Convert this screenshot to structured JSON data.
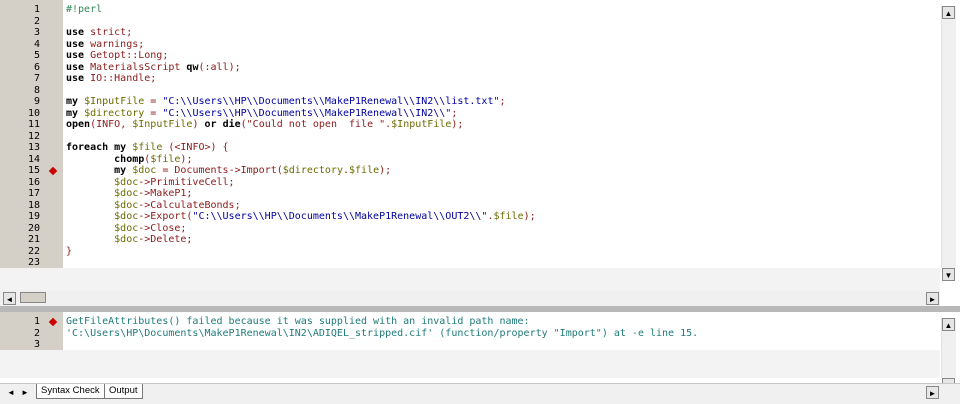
{
  "editor": {
    "lines": [
      {
        "n": "1",
        "segs": [
          {
            "t": "#!perl",
            "c": "cmt"
          }
        ]
      },
      {
        "n": "2",
        "segs": []
      },
      {
        "n": "3",
        "segs": [
          {
            "t": "use",
            "c": "kw"
          },
          {
            "t": " strict;",
            "c": "id"
          }
        ]
      },
      {
        "n": "4",
        "segs": [
          {
            "t": "use",
            "c": "kw"
          },
          {
            "t": " warnings;",
            "c": "id"
          }
        ]
      },
      {
        "n": "5",
        "segs": [
          {
            "t": "use",
            "c": "kw"
          },
          {
            "t": " Getopt::Long;",
            "c": "id"
          }
        ]
      },
      {
        "n": "6",
        "segs": [
          {
            "t": "use",
            "c": "kw"
          },
          {
            "t": " MaterialsScript ",
            "c": "id"
          },
          {
            "t": "qw",
            "c": "kw"
          },
          {
            "t": "(:all);",
            "c": "id"
          }
        ]
      },
      {
        "n": "7",
        "segs": [
          {
            "t": "use",
            "c": "kw"
          },
          {
            "t": " IO::Handle;",
            "c": "id"
          }
        ]
      },
      {
        "n": "8",
        "segs": []
      },
      {
        "n": "9",
        "segs": [
          {
            "t": "my",
            "c": "kw"
          },
          {
            "t": " $InputFile",
            "c": "var"
          },
          {
            "t": " = ",
            "c": "id"
          },
          {
            "t": "\"C:\\\\Users\\\\HP\\\\Documents\\\\MakeP1Renewal\\\\IN2\\\\list.txt\"",
            "c": "str"
          },
          {
            "t": ";",
            "c": "id"
          }
        ]
      },
      {
        "n": "10",
        "segs": [
          {
            "t": "my",
            "c": "kw"
          },
          {
            "t": " $directory",
            "c": "var"
          },
          {
            "t": " = ",
            "c": "id"
          },
          {
            "t": "\"C:\\\\Users\\\\HP\\\\Documents\\\\MakeP1Renewal\\\\IN2\\\\\"",
            "c": "str"
          },
          {
            "t": ";",
            "c": "id"
          }
        ]
      },
      {
        "n": "11",
        "segs": [
          {
            "t": "open",
            "c": "kw"
          },
          {
            "t": "(INFO, ",
            "c": "id"
          },
          {
            "t": "$InputFile",
            "c": "var"
          },
          {
            "t": ") ",
            "c": "id"
          },
          {
            "t": "or die",
            "c": "kw"
          },
          {
            "t": "(\"Could not open  file \".",
            "c": "id"
          },
          {
            "t": "$InputFile",
            "c": "var"
          },
          {
            "t": ");",
            "c": "id"
          }
        ]
      },
      {
        "n": "12",
        "segs": []
      },
      {
        "n": "13",
        "segs": [
          {
            "t": "foreach my",
            "c": "kw"
          },
          {
            "t": " $file",
            "c": "var"
          },
          {
            "t": " (<INFO>) {",
            "c": "id"
          }
        ]
      },
      {
        "n": "14",
        "segs": [
          {
            "t": "        chomp",
            "c": "kw"
          },
          {
            "t": "(",
            "c": "id"
          },
          {
            "t": "$file",
            "c": "var"
          },
          {
            "t": ");",
            "c": "id"
          }
        ]
      },
      {
        "n": "15",
        "bp": true,
        "segs": [
          {
            "t": "        my",
            "c": "kw"
          },
          {
            "t": " $doc",
            "c": "var"
          },
          {
            "t": " = Documents->Import(",
            "c": "id"
          },
          {
            "t": "$directory",
            "c": "var"
          },
          {
            "t": ".",
            "c": "id"
          },
          {
            "t": "$file",
            "c": "var"
          },
          {
            "t": ");",
            "c": "id"
          }
        ]
      },
      {
        "n": "16",
        "segs": [
          {
            "t": "        $doc",
            "c": "var"
          },
          {
            "t": "->PrimitiveCell;",
            "c": "id"
          }
        ]
      },
      {
        "n": "17",
        "segs": [
          {
            "t": "        $doc",
            "c": "var"
          },
          {
            "t": "->MakeP1;",
            "c": "id"
          }
        ]
      },
      {
        "n": "18",
        "segs": [
          {
            "t": "        $doc",
            "c": "var"
          },
          {
            "t": "->CalculateBonds;",
            "c": "id"
          }
        ]
      },
      {
        "n": "19",
        "segs": [
          {
            "t": "        $doc",
            "c": "var"
          },
          {
            "t": "->Export(",
            "c": "id"
          },
          {
            "t": "\"C:\\\\Users\\\\HP\\\\Documents\\\\MakeP1Renewal\\\\OUT2\\\\\"",
            "c": "str"
          },
          {
            "t": ".",
            "c": "id"
          },
          {
            "t": "$file",
            "c": "var"
          },
          {
            "t": ");",
            "c": "id"
          }
        ]
      },
      {
        "n": "20",
        "segs": [
          {
            "t": "        $doc",
            "c": "var"
          },
          {
            "t": "->Close;",
            "c": "id"
          }
        ]
      },
      {
        "n": "21",
        "segs": [
          {
            "t": "        $doc",
            "c": "var"
          },
          {
            "t": "->Delete;",
            "c": "id"
          }
        ]
      },
      {
        "n": "22",
        "segs": [
          {
            "t": "}",
            "c": "id"
          }
        ]
      },
      {
        "n": "23",
        "segs": []
      }
    ]
  },
  "output": {
    "lines": [
      {
        "n": "1",
        "bp": true,
        "segs": [
          {
            "t": "GetFileAttributes() failed because it was supplied with an invalid path name:",
            "c": "out"
          }
        ]
      },
      {
        "n": "2",
        "segs": [
          {
            "t": "'C:\\Users\\HP\\Documents\\MakeP1Renewal\\IN2\\ADIQEL_stripped.cif' (function/property \"Import\") at -e line 15.",
            "c": "out"
          }
        ]
      },
      {
        "n": "3",
        "segs": []
      }
    ]
  },
  "tabs": [
    {
      "label": "Syntax Check",
      "active": false
    },
    {
      "label": "Output",
      "active": true
    }
  ],
  "scroll": {
    "up_glyph": "▲",
    "down_glyph": "▼",
    "left_glyph": "◄",
    "right_glyph": "►"
  }
}
